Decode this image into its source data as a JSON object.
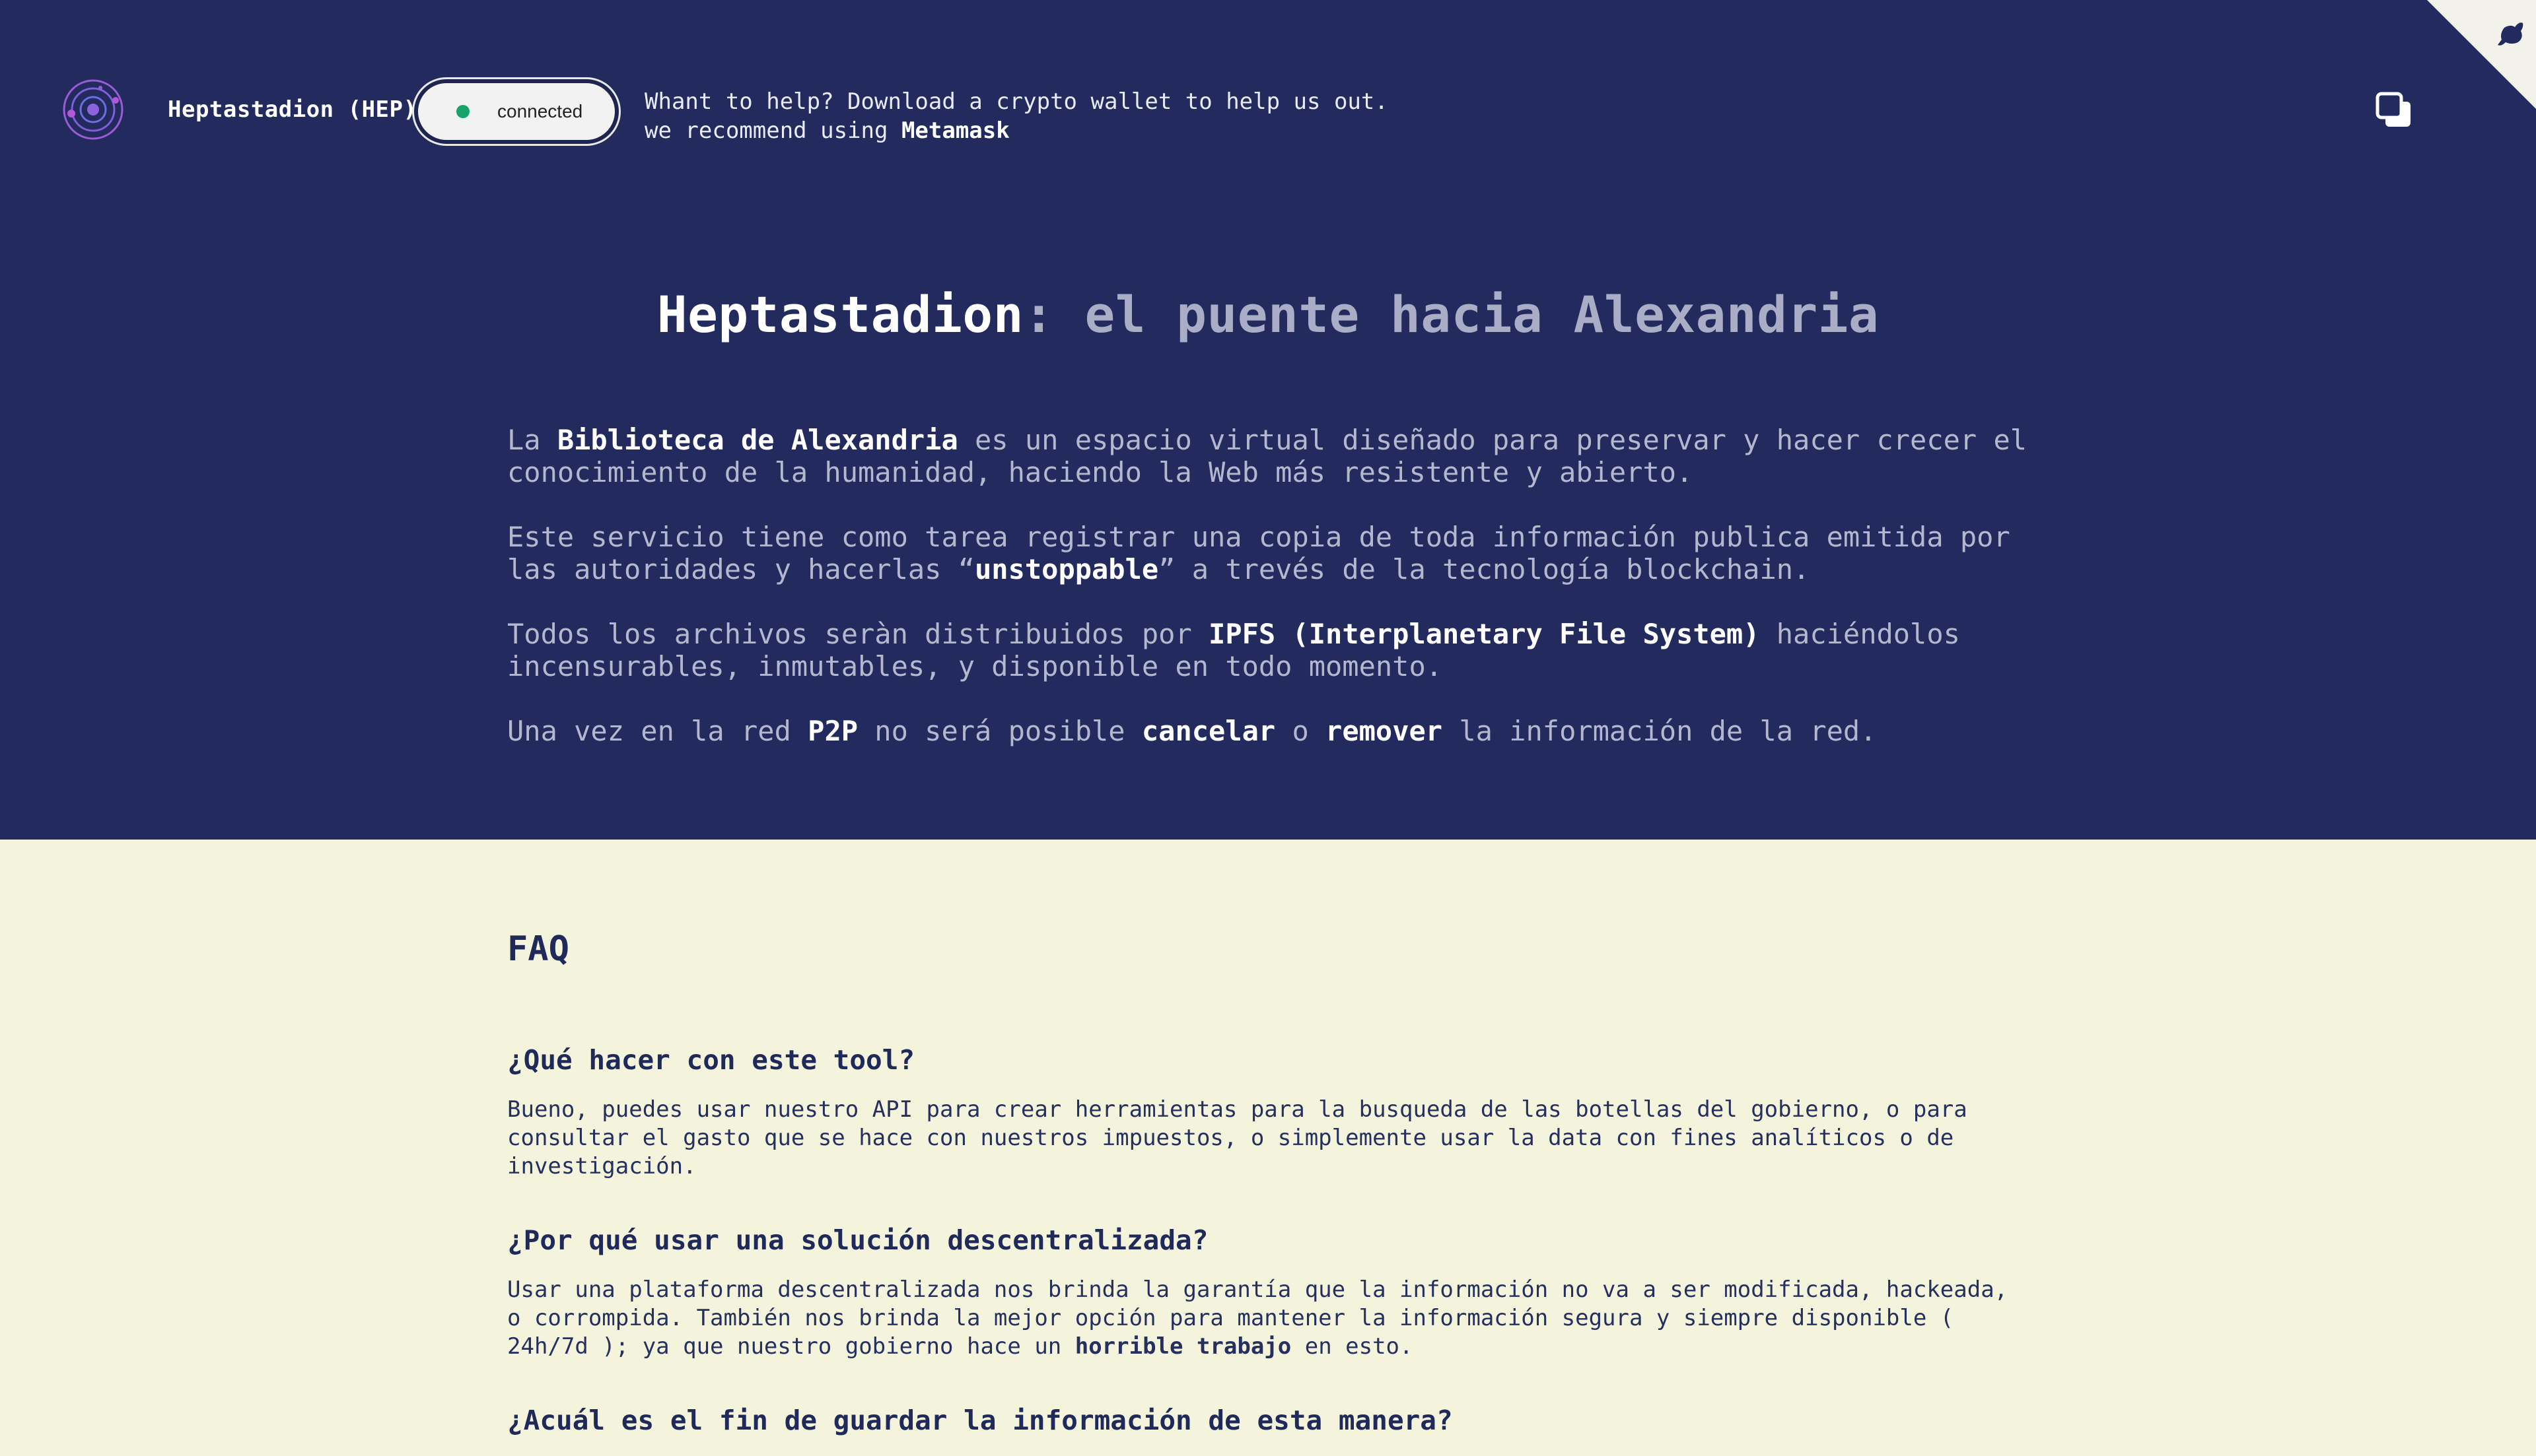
{
  "app": {
    "brand": "Heptastadion (HEP)",
    "status": "connected",
    "status_color": "#17a36b",
    "help_line1": "Whant to help? Download a crypto wallet to help us out.",
    "help_line2_prefix": "we recommend using ",
    "help_link": "Metamask",
    "icons": [
      "galaxy-logo-icon",
      "copy-icon",
      "github-corner-icon"
    ]
  },
  "hero": {
    "title_strong": "Heptastadion",
    "title_rest": ": el puente hacia Alexandria",
    "p1": {
      "a": "La ",
      "b": "Biblioteca de Alexandria",
      "c": " es un espacio virtual diseñado para preservar y hacer crecer el conocimiento de la humanidad, haciendo la Web más resistente y abierto."
    },
    "p2": {
      "a": "Este servicio tiene como tarea registrar una copia de toda información publica emitida por las autoridades y hacerlas “",
      "b": "unstoppable",
      "c": "” a trevés de la tecnología blockchain."
    },
    "p3": {
      "a": "Todos los archivos seràn distribuidos por ",
      "b": "IPFS (Interplanetary File System)",
      "c": " haciéndolos incensurables, inmutables, y disponible en todo momento."
    },
    "p4": {
      "a": "Una vez en la red ",
      "b": "P2P",
      "c": " no será posible ",
      "d": "cancelar",
      "e": " o ",
      "f": "remover",
      "g": " la información de la red."
    }
  },
  "faq": {
    "title": "FAQ",
    "q1": "¿Qué hacer con este tool?",
    "a1": "Bueno, puedes usar nuestro API para crear herramientas para la busqueda de las botellas del gobierno, o para consultar el gasto que se hace con nuestros impuestos, o simplemente usar la data con fines analíticos o de investigación.",
    "q2": "¿Por qué usar una solución descentralizada?",
    "a2_prefix": "Usar una plataforma descentralizada nos brinda la garantía que la información no va a ser modificada, hackeada, o corrompida. También nos brinda la mejor opción para mantener la información segura y siempre disponible ( 24h/7d ); ya que nuestro gobierno hace un ",
    "a2_bold": "horrible trabajo",
    "a2_suffix": " en esto.",
    "q3": "¿Acuál es el fin de guardar la información de esta manera?"
  },
  "colors": {
    "hero_bg": "#222a5e",
    "page_bg": "#f4f4dd",
    "text_dark": "#1f2a5a"
  }
}
